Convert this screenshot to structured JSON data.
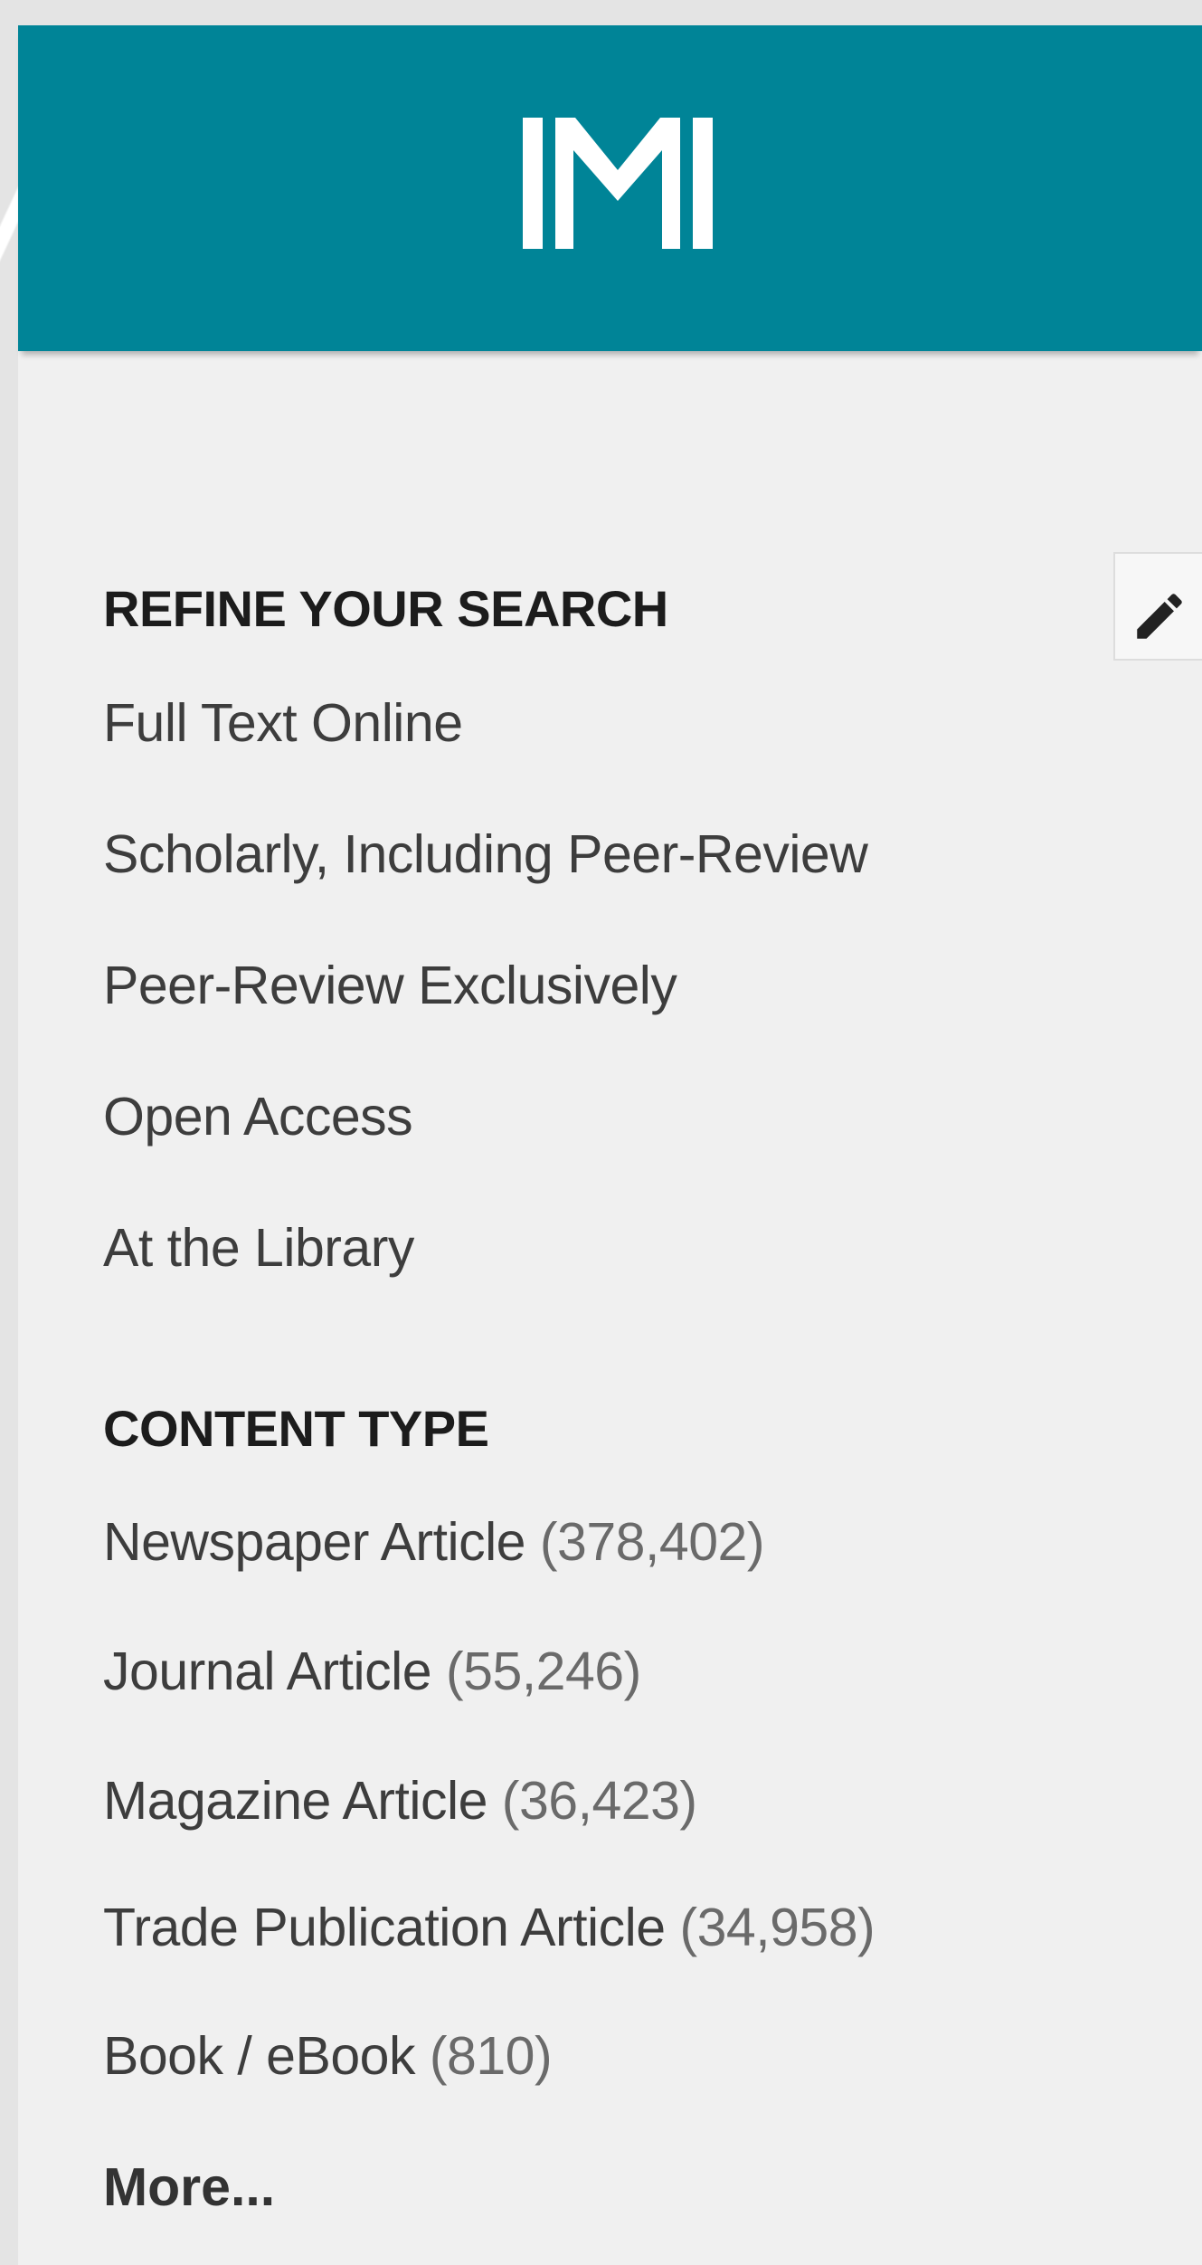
{
  "header": {
    "logo_icon": "m-monogram-logo",
    "background_color": "#008497"
  },
  "toolbar": {
    "edit_icon": "pencil-icon"
  },
  "refine": {
    "heading": "REFINE YOUR SEARCH",
    "items": [
      {
        "label": "Full Text Online"
      },
      {
        "label": "Scholarly, Including Peer-Review"
      },
      {
        "label": "Peer-Review Exclusively"
      },
      {
        "label": "Open Access"
      },
      {
        "label": "At the Library"
      }
    ]
  },
  "content_type": {
    "heading": "CONTENT TYPE",
    "items": [
      {
        "label": "Newspaper Article",
        "count": "(378,402)"
      },
      {
        "label": "Journal Article",
        "count": "(55,246)"
      },
      {
        "label": "Magazine Article",
        "count": "(36,423)"
      },
      {
        "label": "Trade Publication Article",
        "count": "(34,958)"
      },
      {
        "label": "Book / eBook",
        "count": "(810)"
      }
    ],
    "more_label": "More..."
  }
}
